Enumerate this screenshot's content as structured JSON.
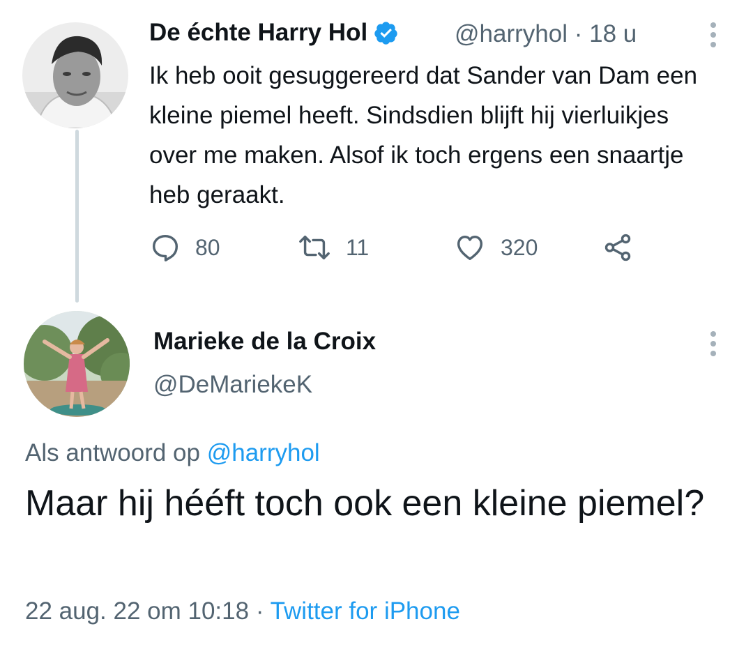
{
  "tweet": {
    "author_name": "De échte Harry Hol",
    "author_handle": "@harryhol",
    "separator": "·",
    "time_ago": "18 u",
    "verified": true,
    "text": "Ik heb ooit gesuggereerd dat Sander van Dam een kleine piemel heeft. Sindsdien blijft hij vierluikjes over me maken. Alsof ik toch ergens een snaartje heb geraakt.",
    "actions": {
      "replies": "80",
      "retweets": "11",
      "likes": "320"
    },
    "icons": [
      "reply-icon",
      "retweet-icon",
      "like-icon",
      "share-icon",
      "verified-badge-icon",
      "more-options-icon"
    ]
  },
  "reply": {
    "author_name": "Marieke de la Croix",
    "author_handle": "@DeMariekeK",
    "replying_to_prefix": "Als antwoord op",
    "replying_to_handle": "@harryhol",
    "text": "Maar hij hééft toch ook een kleine piemel?",
    "date": "22 aug. 22 om 10:18",
    "separator": "·",
    "source": "Twitter for iPhone"
  },
  "colors": {
    "link": "#1d9bf0",
    "text_primary": "#0f1419",
    "text_secondary": "#536471",
    "thread_line": "#cfd9de",
    "verified": "#1d9bf0"
  }
}
